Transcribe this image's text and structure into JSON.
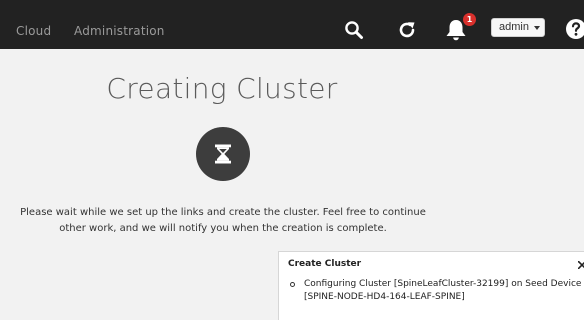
{
  "nav": {
    "links": [
      "Cloud",
      "Administration"
    ],
    "notification_count": "1",
    "user_label": "admin",
    "icons": [
      "search-icon",
      "refresh-icon",
      "bell-icon",
      "chevron-down-icon",
      "help-icon"
    ]
  },
  "main": {
    "title": "Creating Cluster",
    "status_icon": "hourglass-icon",
    "wait_message": "Please wait while we set up the links and create the cluster. Feel free to continue other work, and we will notify you when the creation is complete."
  },
  "cluster_panel": {
    "title": "Create Cluster",
    "items": [
      "Configuring Cluster [SpineLeafCluster-32199] on Seed Device [SPINE-NODE-HD4-164-LEAF-SPINE]"
    ]
  },
  "colors": {
    "nav_bg": "#222222",
    "page_bg": "#f2f2f2",
    "badge": "#d9302c",
    "hourglass_circle": "#3d3d3d"
  }
}
